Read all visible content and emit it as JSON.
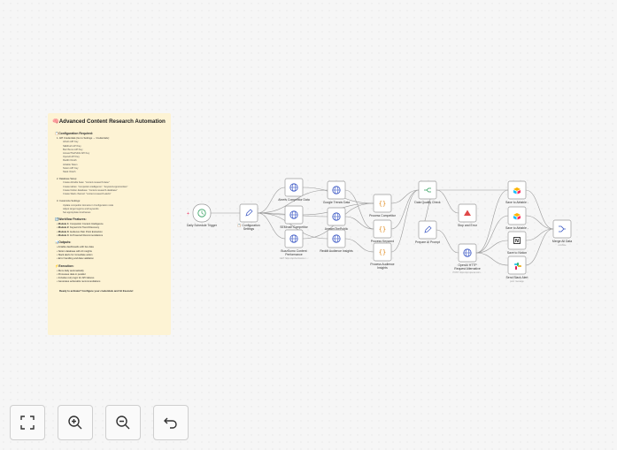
{
  "note": {
    "title": "🧠Advanced Content Research Automation",
    "config_heading": "📋Configuration Required:",
    "api_heading": "1. API Credentials (Go to Settings → Credentials):",
    "api_items": [
      "Ahrefs API Key",
      "SEMrush API Key",
      "BuzzSumo API Key",
      "AnswerThePublic API Key",
      "OpenAI API Key",
      "Reddit OAuth",
      "Airtable Token",
      "Notion API Key",
      "Slack OAuth"
    ],
    "db_heading": "2. Database Setup:",
    "db_items": [
      "Create Airtable base: \"content-research-base\"",
      "Create tables: \"competitor-intelligence\", \"keyword-opportunities\"",
      "Create Notion database: \"content-research-database\"",
      "Create Slack channel: \"content-research-alerts\""
    ],
    "custom_heading": "3. Customize Settings:",
    "custom_items": [
      "Update competitor domains in Configuration node",
      "Adjust target regions and keywords",
      "Set appropriate timeframes"
    ],
    "features_heading": "🔄Workflow Features:",
    "features": [
      {
        "module": "Module 1:",
        "text": " Competitor Content Intelligence"
      },
      {
        "module": "Module 2:",
        "text": " Keyword & Trend Discovery"
      },
      {
        "module": "Module 3:",
        "text": " Audience Pain Point Extraction"
      },
      {
        "module": "Module 4:",
        "text": " AI-Powered Recommendations"
      }
    ],
    "outputs_heading": "📊Outputs:",
    "outputs": [
      "Airtable dashboards with live data",
      "Notion database with AI insights",
      "Slack alerts for immediate action",
      "Error handling and data validation"
    ],
    "execution_heading": "⚡Execution:",
    "execution": [
      "Runs daily automatically",
      "Processes data in parallel",
      "Includes retry logic for API failures",
      "Generates actionable recommendations"
    ],
    "cta": "Ready to activate? Configure your credentials and hit Execute!"
  },
  "nodes": {
    "trigger": {
      "label": "Daily Schedule Trigger",
      "icon": "clock-icon"
    },
    "config": {
      "label": "📋 Configuration Settings",
      "icon": "pencil-icon"
    },
    "ahrefs": {
      "label": "Ahrefs Competitor Data",
      "icon": "globe-icon"
    },
    "semrush": {
      "label": "SEMrush Competitor",
      "icon": "globe-icon"
    },
    "buzzsumo": {
      "label": "BuzzSumo Content Performance",
      "sub": "GET: https://api.buzzsumo.c...",
      "icon": "globe-icon"
    },
    "google_trends": {
      "label": "Google Trends Data",
      "icon": "globe-icon"
    },
    "answer_public": {
      "label": "AnswerThePublic",
      "icon": "globe-icon"
    },
    "reddit": {
      "label": "Reddit Audience Insights",
      "icon": "globe-icon"
    },
    "proc_comp": {
      "label": "Process Competitor",
      "icon": "code-icon"
    },
    "proc_keyword": {
      "label": "Process Keyword",
      "icon": "code-icon"
    },
    "proc_audience": {
      "label": "Process Audience Insights",
      "icon": "code-icon"
    },
    "quality": {
      "label": "Data Quality Check",
      "icon": "split-icon"
    },
    "stop": {
      "label": "Stop and Error",
      "icon": "warning-icon"
    },
    "prompt": {
      "label": "Prepare AI Prompt",
      "icon": "pencil-icon"
    },
    "openai": {
      "label": "OpenAI HTTP Request Alternative",
      "sub": "POST: https://api.openai.com...",
      "icon": "globe-icon"
    },
    "airtable1": {
      "label": "Save to Airtable -",
      "icon": "airtable-icon"
    },
    "airtable2": {
      "label": "Save to Airtable -",
      "icon": "airtable-icon"
    },
    "notion": {
      "label": "Save to Notion",
      "icon": "notion-icon"
    },
    "slack": {
      "label": "Send Slack Alert",
      "sub": "post: message",
      "icon": "slack-icon"
    },
    "merge": {
      "label": "Merge All Data",
      "sub": "combine",
      "icon": "merge-icon"
    }
  },
  "controls": [
    {
      "name": "fit-view-button",
      "icon": "fit-icon"
    },
    {
      "name": "zoom-in-button",
      "icon": "zoom-in-icon"
    },
    {
      "name": "zoom-out-button",
      "icon": "zoom-out-icon"
    },
    {
      "name": "undo-button",
      "icon": "undo-icon"
    }
  ],
  "colors": {
    "canvas": "#f6f6f6",
    "note": "#fdf3d4",
    "node_border": "#9a9a9a",
    "edge": "#9a9a9a",
    "accent_green": "#2e9e5b",
    "error": "#e04848",
    "airtable": "#fcb400",
    "slack": "#4a154b"
  }
}
